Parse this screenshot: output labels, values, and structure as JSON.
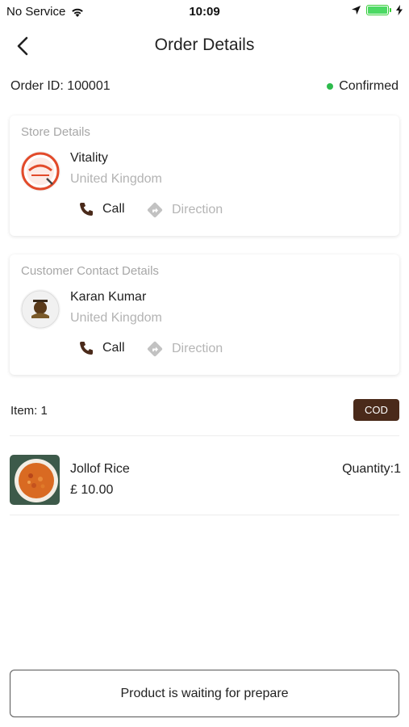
{
  "status_bar": {
    "carrier": "No Service",
    "time": "10:09"
  },
  "header": {
    "title": "Order Details"
  },
  "order": {
    "id_label": "Order ID: 100001",
    "status": "Confirmed",
    "status_color": "#2dbb4c"
  },
  "store_card": {
    "title": "Store Details",
    "name": "Vitality",
    "country": "United Kingdom",
    "call_label": "Call",
    "direction_label": "Direction"
  },
  "customer_card": {
    "title": "Customer Contact Details",
    "name": "Karan Kumar",
    "country": "United Kingdom",
    "call_label": "Call",
    "direction_label": "Direction"
  },
  "items": {
    "count_label": "Item: 1",
    "payment_badge": "COD",
    "badge_color": "#4a2a1a",
    "list": [
      {
        "name": "Jollof Rice",
        "price": "£ 10.00",
        "quantity": "Quantity:1"
      }
    ]
  },
  "footer": {
    "button_label": "Product is waiting for prepare"
  }
}
